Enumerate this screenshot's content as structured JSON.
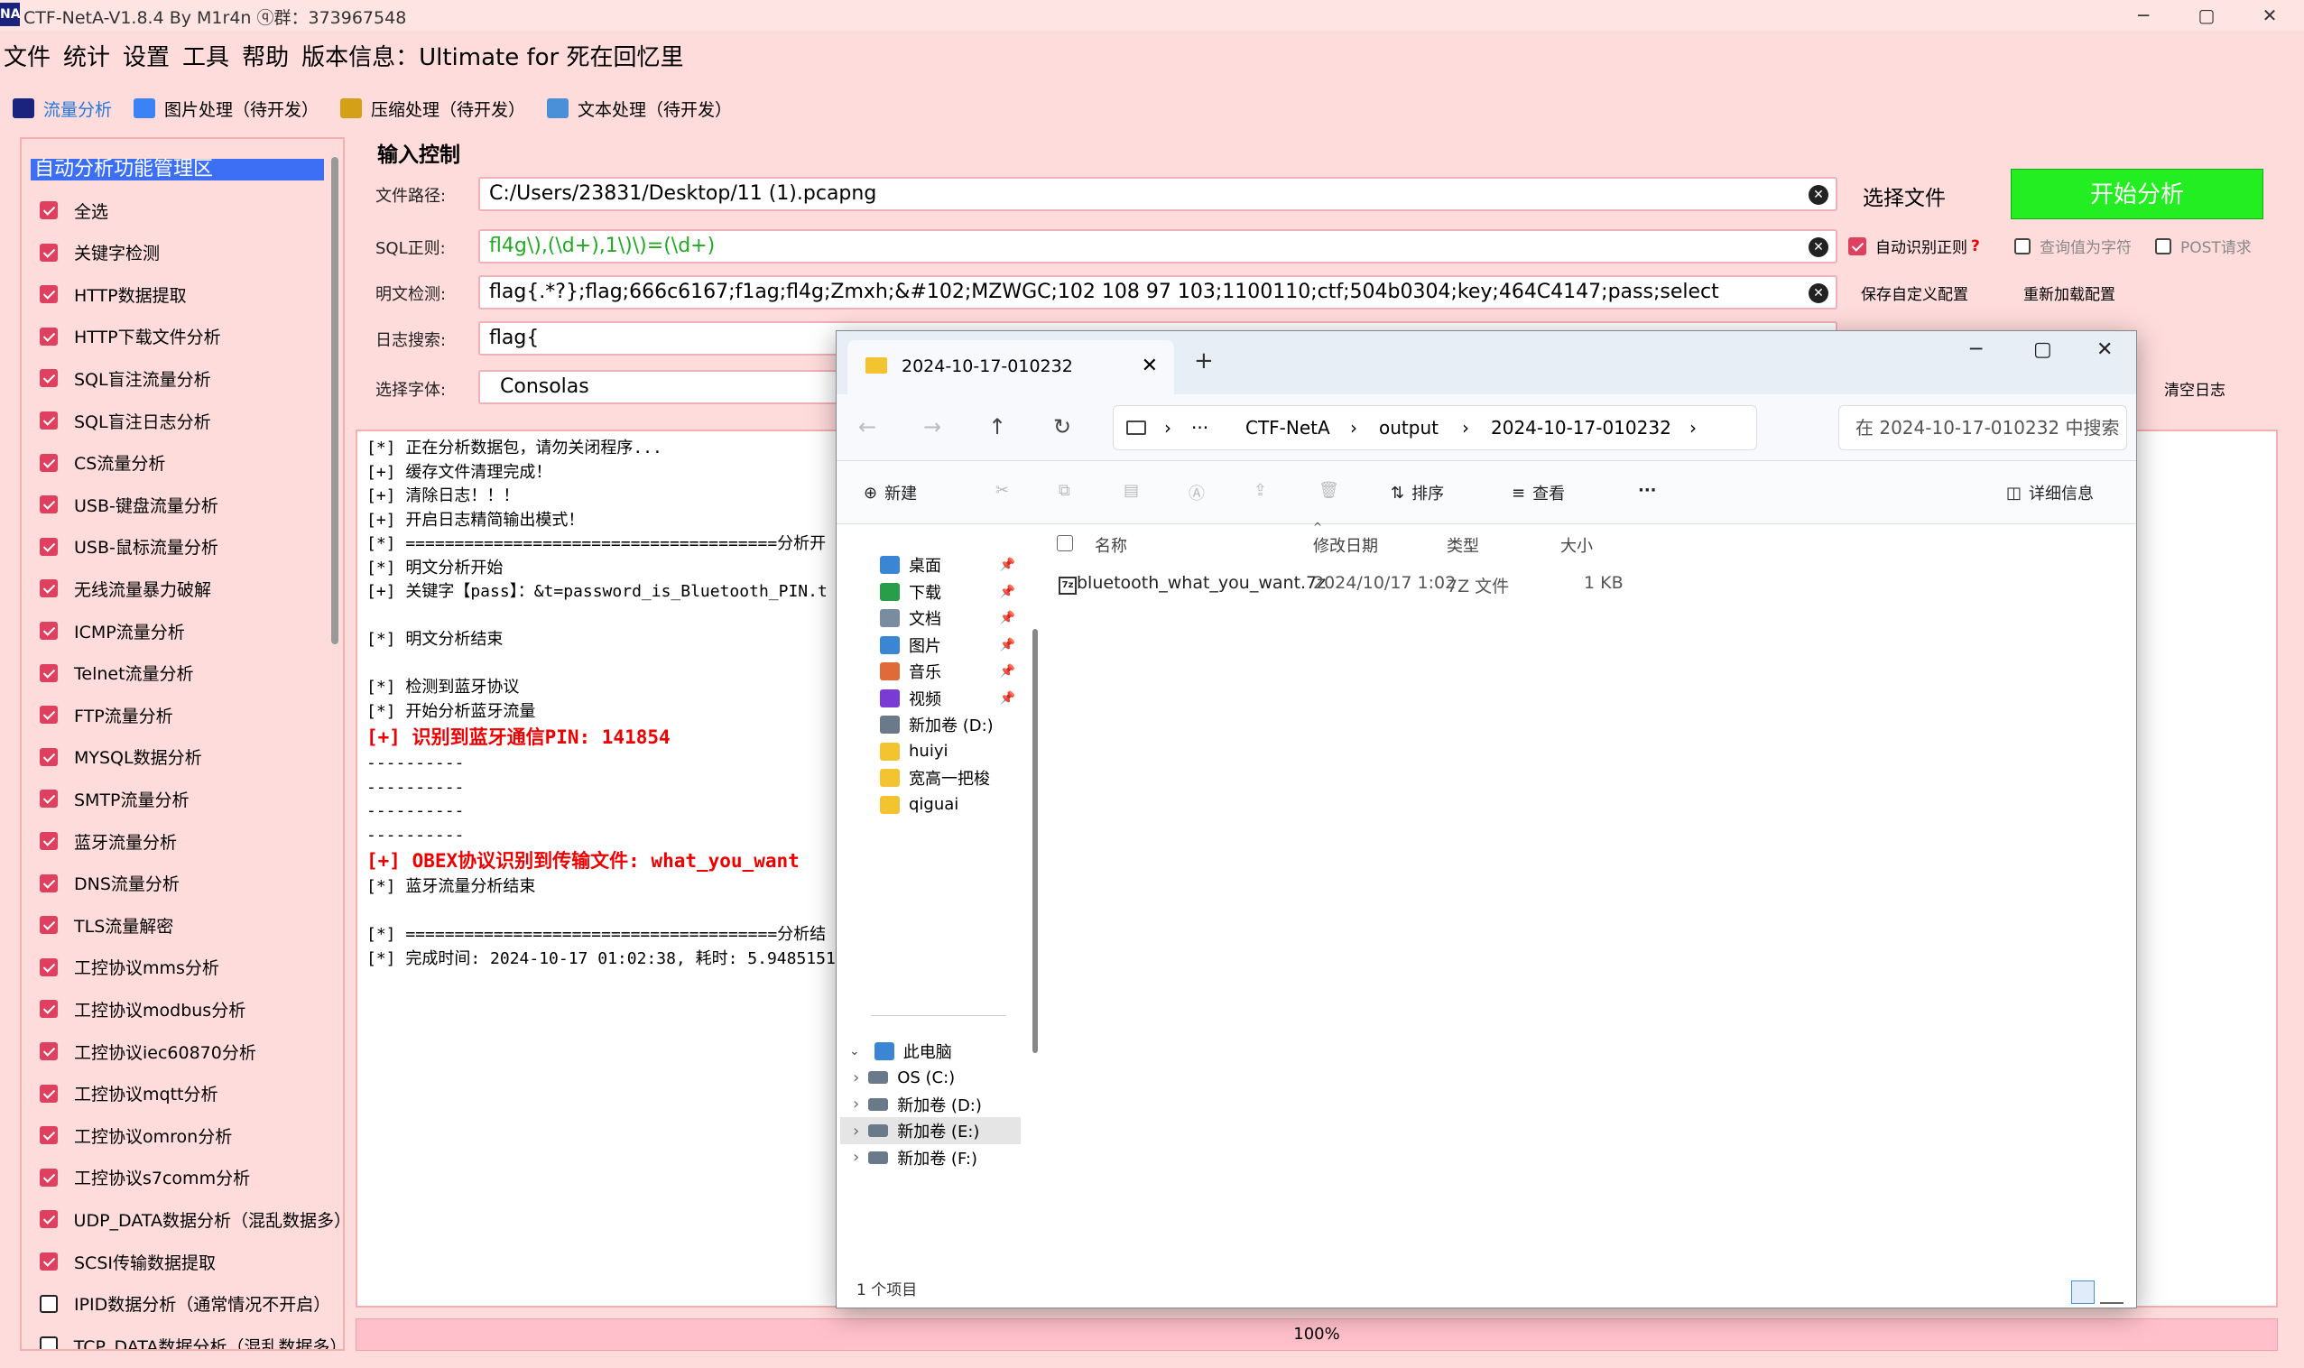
{
  "window": {
    "title": "CTF-NetA-V1.8.4 By M1r4n ⓠ群：373967548",
    "logo": "NA",
    "minimize": "─",
    "maximize": "▢",
    "close": "✕"
  },
  "menu": [
    "文件",
    "统计",
    "设置",
    "工具",
    "帮助",
    "版本信息：Ultimate for 死在回忆里"
  ],
  "tabs": [
    {
      "label": "流量分析",
      "icon": "netA-logo-icon",
      "color": "#1a237e"
    },
    {
      "label": "图片处理（待开发）",
      "icon": "image-icon",
      "color": "#3b82f6"
    },
    {
      "label": "压缩处理（待开发）",
      "icon": "archive-icon",
      "color": "#d4a017"
    },
    {
      "label": "文本处理（待开发）",
      "icon": "text-file-icon",
      "color": "#4a90d9"
    }
  ],
  "leftpanel": {
    "header": "自动分析功能管理区",
    "items": [
      {
        "label": "全选",
        "checked": true
      },
      {
        "label": "关键字检测",
        "checked": true
      },
      {
        "label": "HTTP数据提取",
        "checked": true
      },
      {
        "label": "HTTP下载文件分析",
        "checked": true
      },
      {
        "label": "SQL盲注流量分析",
        "checked": true
      },
      {
        "label": "SQL盲注日志分析",
        "checked": true
      },
      {
        "label": "CS流量分析",
        "checked": true
      },
      {
        "label": "USB-键盘流量分析",
        "checked": true
      },
      {
        "label": "USB-鼠标流量分析",
        "checked": true
      },
      {
        "label": "无线流量暴力破解",
        "checked": true
      },
      {
        "label": "ICMP流量分析",
        "checked": true
      },
      {
        "label": "Telnet流量分析",
        "checked": true
      },
      {
        "label": "FTP流量分析",
        "checked": true
      },
      {
        "label": "MYSQL数据分析",
        "checked": true
      },
      {
        "label": "SMTP流量分析",
        "checked": true
      },
      {
        "label": "蓝牙流量分析",
        "checked": true
      },
      {
        "label": "DNS流量分析",
        "checked": true
      },
      {
        "label": "TLS流量解密",
        "checked": true
      },
      {
        "label": "工控协议mms分析",
        "checked": true
      },
      {
        "label": "工控协议modbus分析",
        "checked": true
      },
      {
        "label": "工控协议iec60870分析",
        "checked": true
      },
      {
        "label": "工控协议mqtt分析",
        "checked": true
      },
      {
        "label": "工控协议omron分析",
        "checked": true
      },
      {
        "label": "工控协议s7comm分析",
        "checked": true
      },
      {
        "label": "UDP_DATA数据分析（混乱数据多）",
        "checked": true
      },
      {
        "label": "SCSI传输数据提取",
        "checked": true
      },
      {
        "label": "IPID数据分析（通常情况不开启）",
        "checked": false
      },
      {
        "label": "TCP_DATA数据分析（混乱数据多）",
        "checked": false
      }
    ]
  },
  "input": {
    "title": "输入控制",
    "file_label": "文件路径:",
    "file_value": "C:/Users/23831/Desktop/11 (1).pcapng",
    "sql_label": "SQL正则:",
    "sql_value": "fl4g\\),(\\d+),1\\)\\)=(\\d+)",
    "plain_label": "明文检测:",
    "plain_value": "flag{.*?};flag;666c6167;f1ag;fl4g;Zmxh;&#102;MZWGC;102 108 97 103;1100110;ctf;504b0304;key;464C4147;pass;select",
    "log_label": "日志搜索:",
    "log_value": "flag{",
    "font_label": "选择字体:",
    "font_value": "Consolas",
    "clear_glyph": "✕"
  },
  "controls": {
    "select_file": "选择文件",
    "start": "开始分析",
    "auto_regex": "自动识别正则",
    "help_mark": "?",
    "query_as_char": "查询值为字符",
    "post_request": "POST请求",
    "save_config": "保存自定义配置",
    "reload_config": "重新加载配置",
    "clear_log": "清空日志"
  },
  "log": {
    "lines": [
      {
        "text": "[*] 正在分析数据包，请勿关闭程序...",
        "red": false
      },
      {
        "text": "[+] 缓存文件清理完成！",
        "red": false
      },
      {
        "text": "[+] 清除日志！！！",
        "red": false
      },
      {
        "text": "[+] 开启日志精简输出模式！",
        "red": false
      },
      {
        "text": "[*] ======================================分析开",
        "red": false
      },
      {
        "text": "[*] 明文分析开始",
        "red": false
      },
      {
        "text": "[+] 关键字【pass】：&t=password_is_Bluetooth_PIN.t",
        "red": false
      },
      {
        "text": "",
        "red": false
      },
      {
        "text": "[*] 明文分析结束",
        "red": false
      },
      {
        "text": "",
        "red": false
      },
      {
        "text": "[*] 检测到蓝牙协议",
        "red": false
      },
      {
        "text": "[*] 开始分析蓝牙流量",
        "red": false
      },
      {
        "text": "[+] 识别到蓝牙通信PIN: 141854",
        "red": true
      },
      {
        "text": "----------",
        "red": false
      },
      {
        "text": "----------",
        "red": false
      },
      {
        "text": "----------",
        "red": false
      },
      {
        "text": "----------",
        "red": false
      },
      {
        "text": "[+] OBEX协议识别到传输文件: what_you_want",
        "red": true
      },
      {
        "text": "[*] 蓝牙流量分析结束",
        "red": false
      },
      {
        "text": "",
        "red": false
      },
      {
        "text": "[*] ======================================分析结",
        "red": false
      },
      {
        "text": "[*] 完成时间: 2024-10-17 01:02:38, 耗时: 5.9485151",
        "red": false
      }
    ]
  },
  "progress": {
    "text": "100%",
    "value": 1.0
  },
  "explorer": {
    "tab_title": "2024-10-17-010232",
    "tab_close": "✕",
    "new_tab": "+",
    "win_min": "─",
    "win_max": "▢",
    "win_close": "✕",
    "nav_back": "←",
    "nav_fwd": "→",
    "nav_up": "↑",
    "nav_refresh": "↻",
    "breadcrumb": [
      "CTF-NetA",
      "output",
      "2024-10-17-010232"
    ],
    "crumb_sep": "›",
    "more": "···",
    "search_placeholder": "在 2024-10-17-010232 中搜索",
    "toolbar": {
      "new": "新建",
      "sort": "排序",
      "view": "查看",
      "more": "···",
      "details": "详细信息"
    },
    "quick_access": [
      {
        "label": "桌面",
        "icon": "desktop-icon",
        "color": "#3a86d4",
        "pinned": true
      },
      {
        "label": "下载",
        "icon": "download-icon",
        "color": "#2a9d4a",
        "pinned": true
      },
      {
        "label": "文档",
        "icon": "documents-icon",
        "color": "#7a8ca0",
        "pinned": true
      },
      {
        "label": "图片",
        "icon": "pictures-icon",
        "color": "#3a86d4",
        "pinned": true
      },
      {
        "label": "音乐",
        "icon": "music-icon",
        "color": "#e06a3a",
        "pinned": true
      },
      {
        "label": "视频",
        "icon": "videos-icon",
        "color": "#7a3ad4",
        "pinned": true
      },
      {
        "label": "新加卷 (D:)",
        "icon": "drive-icon",
        "color": "#6a7a8a",
        "pinned": false
      },
      {
        "label": "huiyi",
        "icon": "folder-icon",
        "color": "#f4c430",
        "pinned": false
      },
      {
        "label": "宽高一把梭",
        "icon": "folder-icon",
        "color": "#f4c430",
        "pinned": false
      },
      {
        "label": "qiguai",
        "icon": "folder-icon",
        "color": "#f4c430",
        "pinned": false
      }
    ],
    "this_pc": "此电脑",
    "drives": [
      "OS (C:)",
      "新加卷 (D:)",
      "新加卷 (E:)",
      "新加卷 (F:)"
    ],
    "selected_drive": "新加卷 (E:)",
    "columns": {
      "name": "名称",
      "date": "修改日期",
      "type": "类型",
      "size": "大小"
    },
    "files": [
      {
        "name": "bluetooth_what_you_want.7z",
        "date": "2024/10/17 1:02",
        "type": "7Z 文件",
        "size": "1 KB"
      }
    ],
    "status": "1 个项目"
  }
}
